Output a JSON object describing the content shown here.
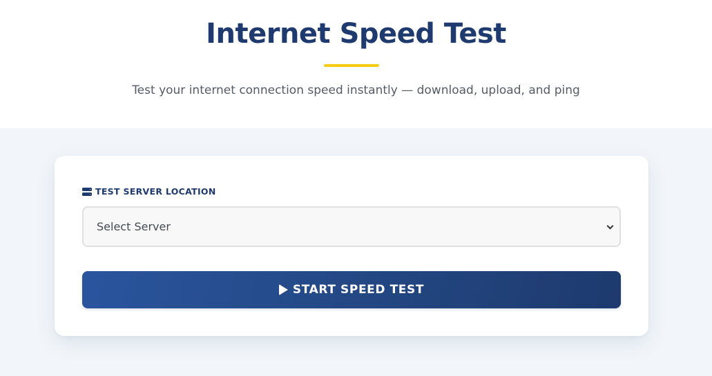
{
  "header": {
    "title": "Internet Speed Test",
    "subtitle": "Test your internet connection speed instantly — download, upload, and ping"
  },
  "form": {
    "server_label": "TEST SERVER LOCATION",
    "server_label_icon": "server-icon",
    "server_select_value": "Select Server",
    "start_button_label": "START SPEED TEST",
    "start_button_icon": "play-icon"
  },
  "colors": {
    "primary": "#1e3a6e",
    "accent": "#f5cc14",
    "background": "#f2f6fa"
  }
}
